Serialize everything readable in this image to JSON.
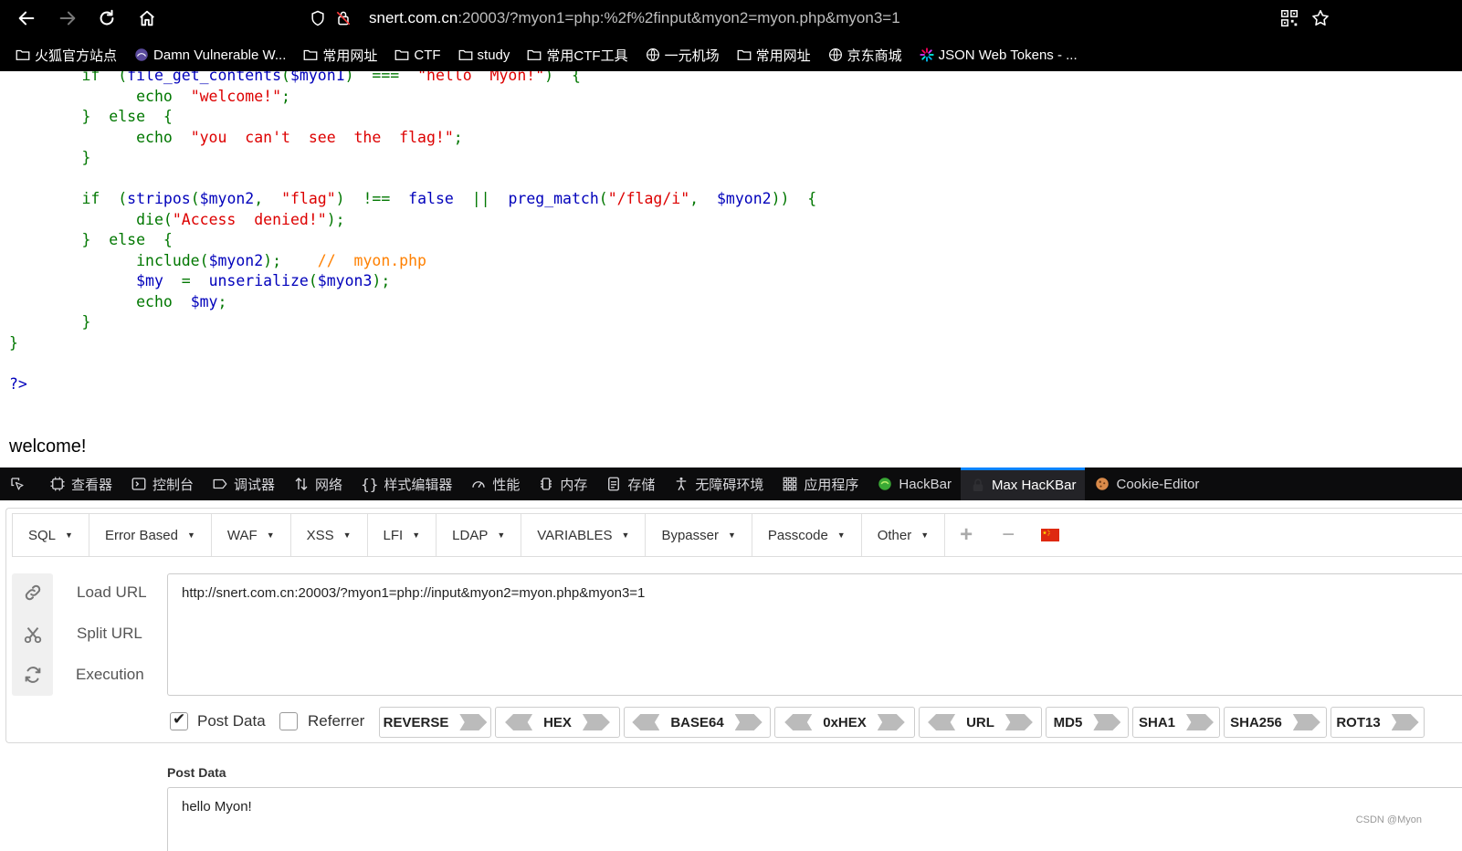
{
  "browser": {
    "url_host": "snert.com.cn",
    "url_rest": ":20003/?myon1=php:%2f%2finput&myon2=myon.php&myon3=1",
    "bookmarks": [
      {
        "label": "火狐官方站点",
        "icon": "folder-icon"
      },
      {
        "label": "Damn Vulnerable W...",
        "icon": "dvwa-icon"
      },
      {
        "label": "常用网址",
        "icon": "folder-icon"
      },
      {
        "label": "CTF",
        "icon": "folder-icon"
      },
      {
        "label": "study",
        "icon": "folder-icon"
      },
      {
        "label": "常用CTF工具",
        "icon": "folder-icon"
      },
      {
        "label": "一元机场",
        "icon": "globe-icon"
      },
      {
        "label": "常用网址",
        "icon": "folder-icon"
      },
      {
        "label": "京东商城",
        "icon": "globe-icon"
      },
      {
        "label": "JSON Web Tokens - ...",
        "icon": "jwt-icon"
      }
    ]
  },
  "page": {
    "code_lines": [
      {
        "indent": "        ",
        "parts": [
          [
            "kw",
            "if  ("
          ],
          [
            "fn",
            "file_get_contents"
          ],
          [
            "kw",
            "("
          ],
          [
            "fn",
            "$myon1"
          ],
          [
            "kw",
            ")  ===  "
          ],
          [
            "str",
            "\"hello  Myon!\""
          ],
          [
            "kw",
            ")  {"
          ]
        ]
      },
      {
        "indent": "              ",
        "parts": [
          [
            "kw",
            "echo  "
          ],
          [
            "str",
            "\"welcome!\""
          ],
          [
            "kw",
            ";"
          ]
        ]
      },
      {
        "indent": "        ",
        "parts": [
          [
            "kw",
            "}  else  {"
          ]
        ]
      },
      {
        "indent": "              ",
        "parts": [
          [
            "kw",
            "echo  "
          ],
          [
            "str",
            "\"you  can't  see  the  flag!\""
          ],
          [
            "kw",
            ";"
          ]
        ]
      },
      {
        "indent": "        ",
        "parts": [
          [
            "kw",
            "}"
          ]
        ]
      },
      {
        "indent": "",
        "parts": []
      },
      {
        "indent": "        ",
        "parts": [
          [
            "kw",
            "if  ("
          ],
          [
            "fn",
            "stripos"
          ],
          [
            "kw",
            "("
          ],
          [
            "fn",
            "$myon2"
          ],
          [
            "kw",
            ",  "
          ],
          [
            "str",
            "\"flag\""
          ],
          [
            "kw",
            ")  !==  "
          ],
          [
            "fn",
            "false  "
          ],
          [
            "kw",
            "||  "
          ],
          [
            "fn",
            "preg_match"
          ],
          [
            "kw",
            "("
          ],
          [
            "str",
            "\"/flag/i\""
          ],
          [
            "kw",
            ",  "
          ],
          [
            "fn",
            "$myon2"
          ],
          [
            "kw",
            "))  {"
          ]
        ]
      },
      {
        "indent": "              ",
        "parts": [
          [
            "kw",
            "die("
          ],
          [
            "str",
            "\"Access  denied!\""
          ],
          [
            "kw",
            ");"
          ]
        ]
      },
      {
        "indent": "        ",
        "parts": [
          [
            "kw",
            "}  else  {"
          ]
        ]
      },
      {
        "indent": "              ",
        "parts": [
          [
            "kw",
            "include("
          ],
          [
            "fn",
            "$myon2"
          ],
          [
            "kw",
            ");    "
          ],
          [
            "cm",
            "//  myon.php"
          ]
        ]
      },
      {
        "indent": "              ",
        "parts": [
          [
            "fn",
            "$my  "
          ],
          [
            "kw",
            "=  "
          ],
          [
            "fn",
            "unserialize"
          ],
          [
            "kw",
            "("
          ],
          [
            "fn",
            "$myon3"
          ],
          [
            "kw",
            ");"
          ]
        ]
      },
      {
        "indent": "              ",
        "parts": [
          [
            "kw",
            "echo  "
          ],
          [
            "fn",
            "$my"
          ],
          [
            "kw",
            ";"
          ]
        ]
      },
      {
        "indent": "        ",
        "parts": [
          [
            "kw",
            "}"
          ]
        ]
      },
      {
        "indent": "",
        "parts": [
          [
            "kw",
            "}"
          ]
        ]
      },
      {
        "indent": "",
        "parts": []
      },
      {
        "indent": "",
        "parts": [
          [
            "fn",
            "?>"
          ]
        ]
      }
    ],
    "output": "welcome!"
  },
  "devtools": {
    "tabs": [
      {
        "label": "",
        "icon": "pick-element-icon",
        "active": false
      },
      {
        "label": "查看器",
        "icon": "inspector-icon",
        "active": false
      },
      {
        "label": "控制台",
        "icon": "console-icon",
        "active": false
      },
      {
        "label": "调试器",
        "icon": "debugger-icon",
        "active": false
      },
      {
        "label": "网络",
        "icon": "network-icon",
        "active": false
      },
      {
        "label": "样式编辑器",
        "icon": "style-editor-icon",
        "active": false
      },
      {
        "label": "性能",
        "icon": "performance-icon",
        "active": false
      },
      {
        "label": "内存",
        "icon": "memory-icon",
        "active": false
      },
      {
        "label": "存储",
        "icon": "storage-icon",
        "active": false
      },
      {
        "label": "无障碍环境",
        "icon": "accessibility-icon",
        "active": false
      },
      {
        "label": "应用程序",
        "icon": "application-icon",
        "active": false
      },
      {
        "label": "HackBar",
        "icon": "hackbar-icon",
        "active": false
      },
      {
        "label": "Max HacKBar",
        "icon": "max-hackbar-icon",
        "active": true
      },
      {
        "label": "Cookie-Editor",
        "icon": "cookie-icon",
        "active": false
      }
    ]
  },
  "hackbar": {
    "menus": [
      "SQL",
      "Error Based",
      "WAF",
      "XSS",
      "LFI",
      "LDAP",
      "VARIABLES",
      "Bypasser",
      "Passcode",
      "Other"
    ],
    "add_symbol": "+",
    "remove_symbol": "−",
    "load_url": "Load URL",
    "split_url": "Split URL",
    "execution": "Execution",
    "url_value": "http://snert.com.cn:20003/?myon1=php://input&myon2=myon.php&myon3=1",
    "post_data_label": "Post Data",
    "post_data_checked": true,
    "referrer_label": "Referrer",
    "referrer_checked": false,
    "encode_buttons": [
      "REVERSE",
      "HEX",
      "BASE64",
      "0xHEX",
      "URL",
      "MD5",
      "SHA1",
      "SHA256",
      "ROT13"
    ],
    "post_data_title": "Post Data",
    "post_data_value": "hello Myon!",
    "watermark": "CSDN @Myon⁠"
  }
}
